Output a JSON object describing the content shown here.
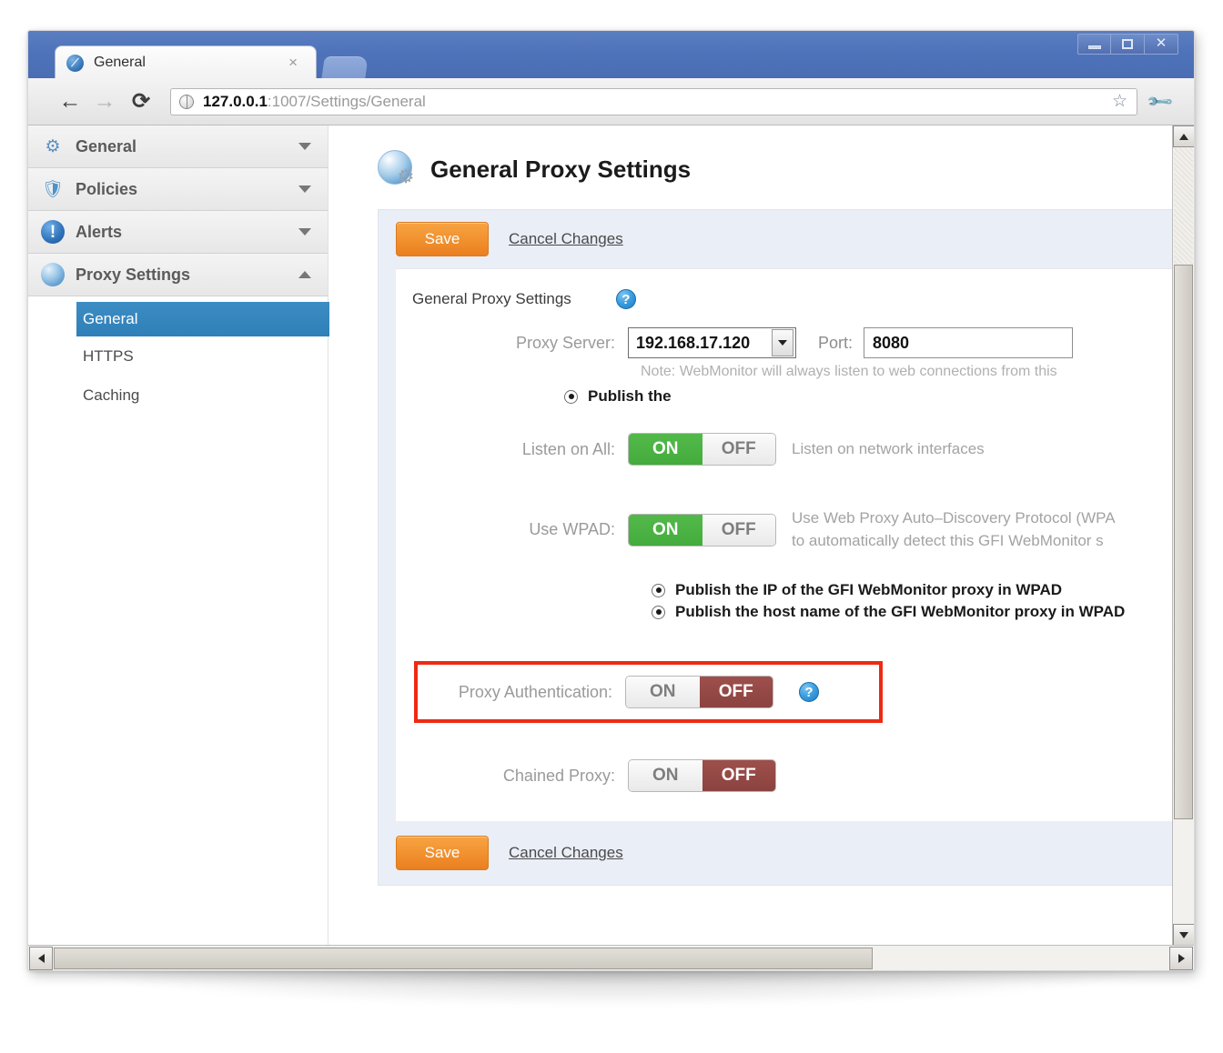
{
  "window": {
    "minimize_label": "Minimize",
    "maximize_label": "Maximize",
    "close_label": "Close"
  },
  "browser": {
    "tab": {
      "title": "General",
      "favicon": "webmonitor-favicon",
      "close_label": "×"
    },
    "nav": {
      "back": "←",
      "forward": "→",
      "reload": "⟳"
    },
    "omnibox": {
      "host": "127.0.0.1",
      "rest": ":1007/Settings/General",
      "full_url": "127.0.0.1:1007/Settings/General",
      "star_label": "☆"
    },
    "wrench_label": "Customize"
  },
  "sidebar": {
    "groups": [
      {
        "label": "General",
        "icon": "gear-icon",
        "expanded": false,
        "caret": "down"
      },
      {
        "label": "Policies",
        "icon": "shield-icon",
        "expanded": false,
        "caret": "down"
      },
      {
        "label": "Alerts",
        "icon": "alert-icon",
        "expanded": false,
        "caret": "down"
      },
      {
        "label": "Proxy Settings",
        "icon": "globe-icon",
        "expanded": true,
        "caret": "up"
      }
    ],
    "subitems": [
      {
        "label": "General",
        "active": true
      },
      {
        "label": "HTTPS",
        "active": false
      },
      {
        "label": "Caching",
        "active": false
      }
    ]
  },
  "main": {
    "page_title": "General Proxy Settings",
    "page_icon": "globe-gear-icon",
    "toolbar_top": {
      "save_label": "Save",
      "cancel_label": "Cancel Changes"
    },
    "toolbar_bottom": {
      "save_label": "Save",
      "cancel_label": "Cancel Changes"
    },
    "section": {
      "title": "General Proxy Settings",
      "help_label": "?"
    },
    "fields": {
      "proxy_server": {
        "label": "Proxy Server:",
        "value": "192.168.17.120",
        "options": [
          "192.168.17.120"
        ]
      },
      "port": {
        "label": "Port:",
        "value": "8080"
      },
      "note": "Note: WebMonitor will always listen to web connections from this",
      "publish_the": {
        "label": "Publish the",
        "checked": true
      },
      "listen_on_all": {
        "label": "Listen on All:",
        "on_label": "ON",
        "off_label": "OFF",
        "state": "on",
        "description": "Listen on network interfaces"
      },
      "use_wpad": {
        "label": "Use WPAD:",
        "on_label": "ON",
        "off_label": "OFF",
        "state": "on",
        "description_line1": "Use Web Proxy Auto–Discovery Protocol (WPA",
        "description_line2": "to automatically detect this GFI WebMonitor s"
      },
      "wpad_radios": [
        {
          "label": "Publish the IP of the GFI WebMonitor proxy in WPAD",
          "checked": true
        },
        {
          "label": "Publish the host name of the GFI WebMonitor proxy in WPAD",
          "checked": true
        }
      ],
      "proxy_authentication": {
        "label": "Proxy Authentication:",
        "on_label": "ON",
        "off_label": "OFF",
        "state": "off",
        "help_label": "?",
        "highlighted": true,
        "highlight_color": "#ee2a13"
      },
      "chained_proxy": {
        "label": "Chained Proxy:",
        "on_label": "ON",
        "off_label": "OFF",
        "state": "off"
      }
    }
  },
  "scrollbars": {
    "vertical": {
      "up_label": "▲",
      "down_label": "▼"
    },
    "horizontal": {
      "left_label": "◀",
      "right_label": "▶"
    }
  },
  "colors": {
    "accent_orange": "#ef8c2a",
    "toggle_on_green": "#4cb244",
    "toggle_off_red": "#94463f",
    "sidebar_active_blue": "#3080ba",
    "highlight_red": "#ee2a13",
    "panel_bg": "#eaeef7"
  }
}
